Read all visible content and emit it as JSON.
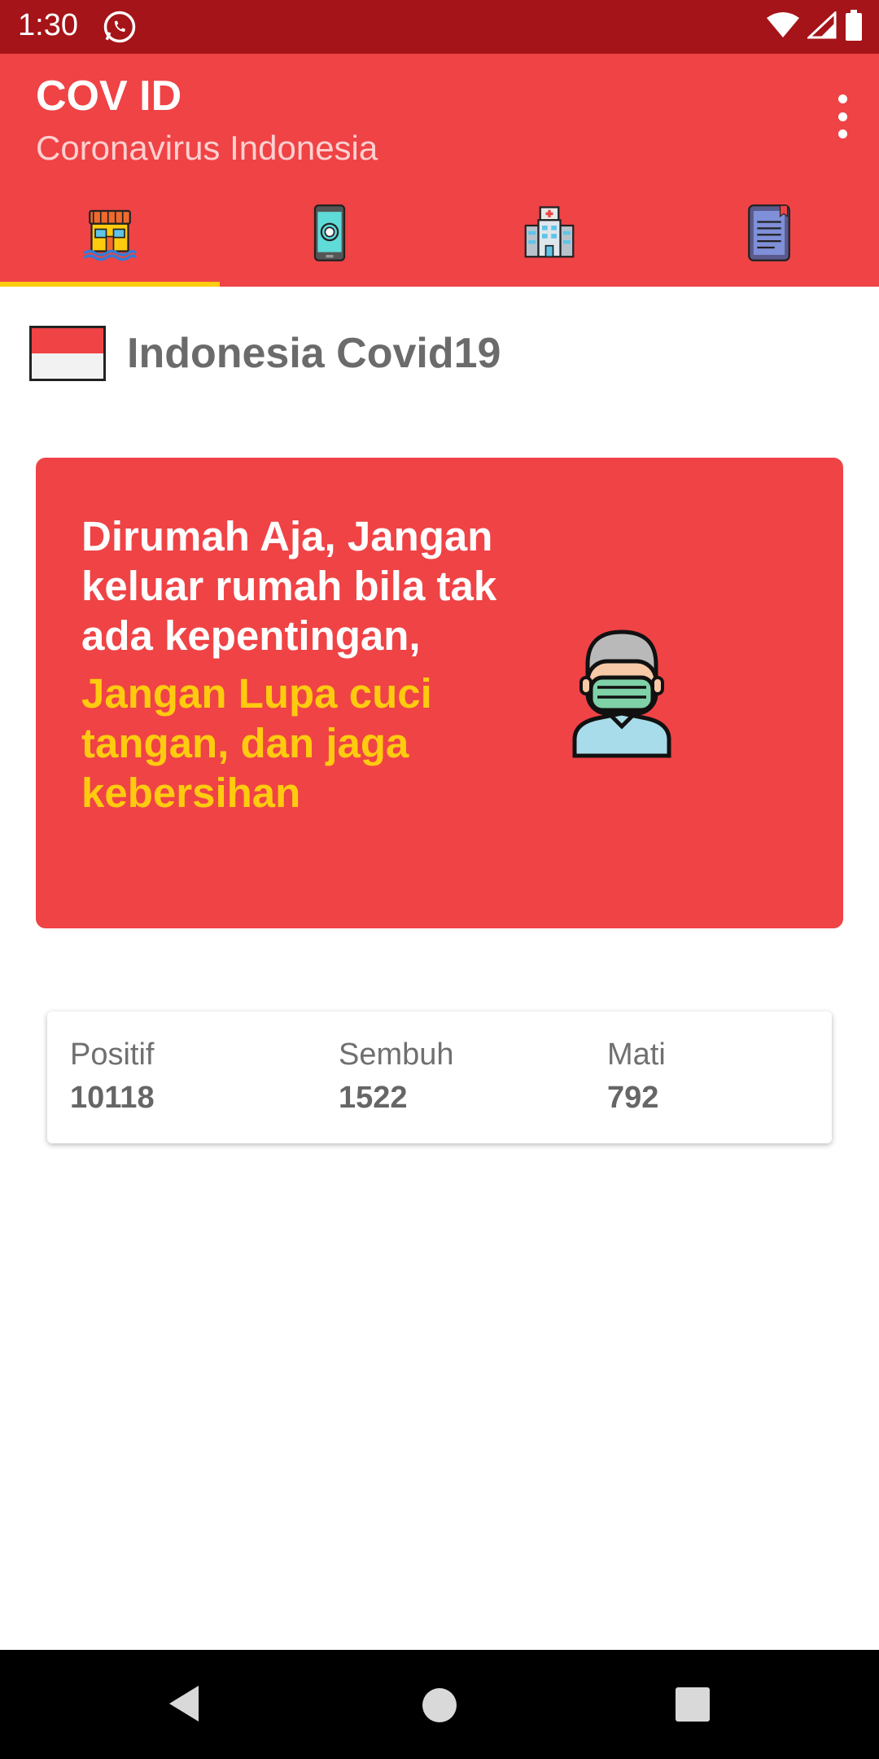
{
  "status": {
    "time": "1:30",
    "icons": [
      "whatsapp-icon",
      "wifi-icon",
      "signal-icon",
      "battery-icon"
    ]
  },
  "app_bar": {
    "title": "COV ID",
    "subtitle": "Coronavirus Indonesia",
    "menu_icon": "more-vert-icon"
  },
  "tabs": [
    {
      "icon": "home-icon",
      "active": true
    },
    {
      "icon": "phone-app-icon",
      "active": false
    },
    {
      "icon": "hospital-icon",
      "active": false
    },
    {
      "icon": "news-icon",
      "active": false
    }
  ],
  "content": {
    "flag_icon": "indonesia-flag-icon",
    "title": "Indonesia Covid19"
  },
  "banner": {
    "message_white": "Dirumah Aja, Jangan keluar rumah bila tak ada kepentingan,",
    "message_yellow": "Jangan Lupa cuci tangan, dan jaga kebersihan",
    "illustration": "doctor-mask-icon"
  },
  "stats": [
    {
      "label": "Positif",
      "value": "10118"
    },
    {
      "label": "Sembuh",
      "value": "1522"
    },
    {
      "label": "Mati",
      "value": "792"
    }
  ],
  "nav": [
    "back-icon",
    "home-circle-icon",
    "recents-icon"
  ],
  "colors": {
    "status_bar": "#a51418",
    "primary": "#ef4346",
    "accent_yellow": "#ffcb0f"
  }
}
